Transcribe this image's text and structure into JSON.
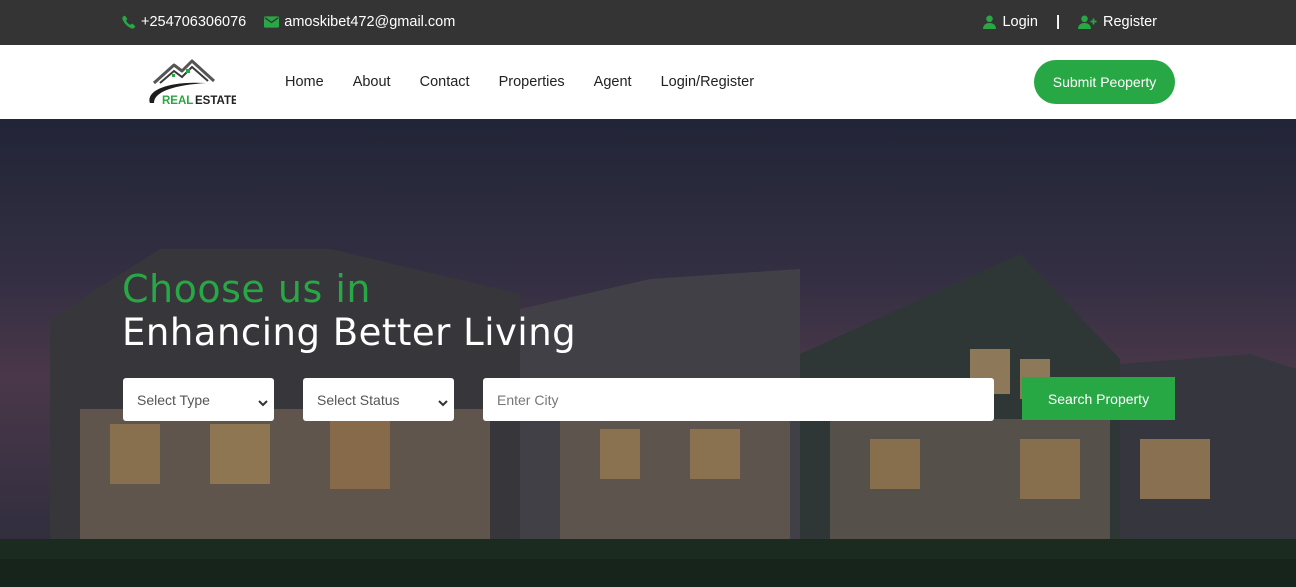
{
  "topbar": {
    "phone": "+254706306076",
    "email": "amoskibet472@gmail.com",
    "login": "Login",
    "separator": "|",
    "register": "Register",
    "icons": {
      "phone": "phone-icon",
      "email": "envelope-icon",
      "login": "user-icon",
      "register": "user-plus-icon"
    }
  },
  "navbar": {
    "logo_text_green": "REAL",
    "logo_text_dark": "ESTATE",
    "links": [
      "Home",
      "About",
      "Contact",
      "Properties",
      "Agent",
      "Login/Register"
    ],
    "submit_button": "Submit Peoperty"
  },
  "hero": {
    "line1": "Choose us in",
    "line2": "Enhancing Better Living",
    "search": {
      "type_selected": "Select Type",
      "status_selected": "Select Status",
      "city_placeholder": "Enter City",
      "button": "Search Property"
    }
  },
  "colors": {
    "accent": "#28a745",
    "topbar": "#343434",
    "text_dark": "#222222"
  }
}
